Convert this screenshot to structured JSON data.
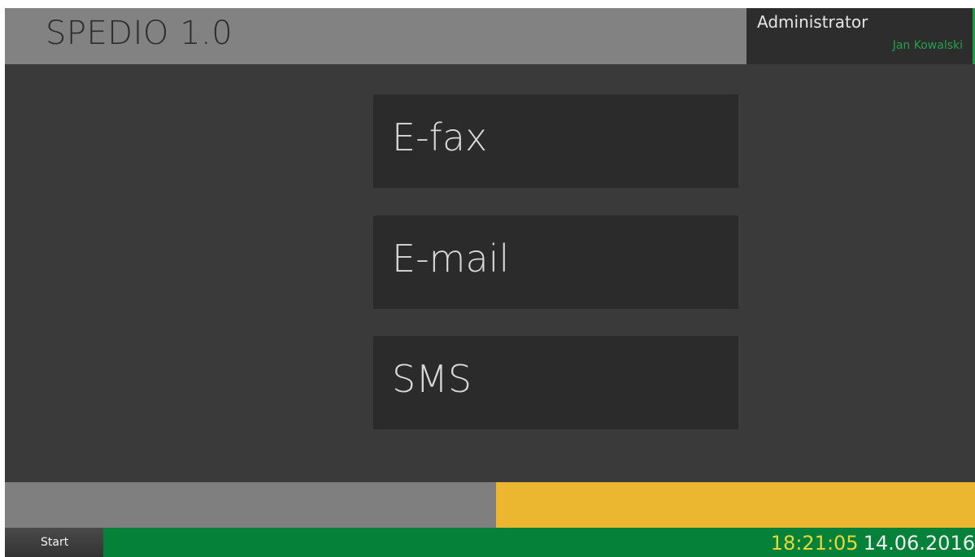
{
  "header": {
    "app_title": "SPEDIO 1.0"
  },
  "user": {
    "role": "Administrator",
    "name": "Jan Kowalski"
  },
  "menu": {
    "items": [
      {
        "label": "E-fax"
      },
      {
        "label": "E-mail"
      },
      {
        "label": "SMS"
      }
    ]
  },
  "taskbar": {
    "start_label": "Start",
    "time": "18:21:05",
    "date": "14.06.2016"
  },
  "colors": {
    "header_bg": "#828282",
    "body_bg": "#3a3a3a",
    "tile_bg": "#2b2b2b",
    "accent_green": "#068139",
    "accent_yellow": "#ebb731",
    "user_name_green": "#22a14a",
    "clock_yellow": "#e8d836"
  }
}
